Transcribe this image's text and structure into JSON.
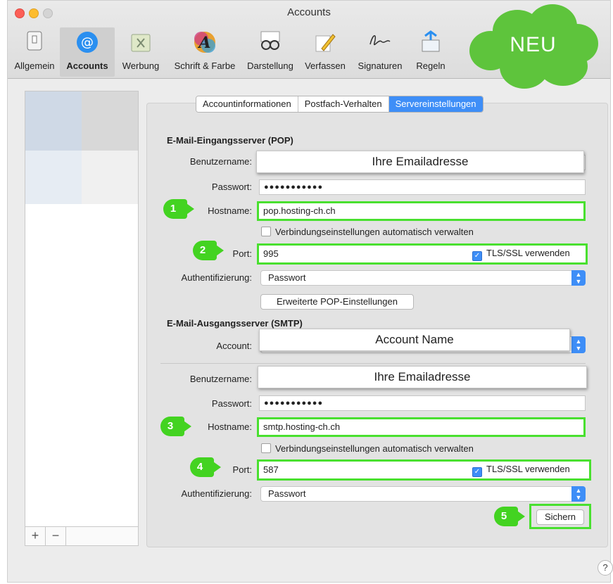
{
  "window": {
    "title": "Accounts"
  },
  "toolbar": {
    "items": [
      {
        "label": "Allgemein",
        "icon": "general-switch-icon"
      },
      {
        "label": "Accounts",
        "icon": "at-sign-icon"
      },
      {
        "label": "Werbung",
        "icon": "junk-bin-icon"
      },
      {
        "label": "Schrift & Farbe",
        "icon": "font-color-icon"
      },
      {
        "label": "Darstellung",
        "icon": "glasses-icon"
      },
      {
        "label": "Verfassen",
        "icon": "pencil-icon"
      },
      {
        "label": "Signaturen",
        "icon": "signature-icon"
      },
      {
        "label": "Regeln",
        "icon": "rules-envelope-icon"
      }
    ]
  },
  "badge": {
    "text": "NEU",
    "color": "#5ec43c"
  },
  "tabs": [
    {
      "label": "Accountinformationen"
    },
    {
      "label": "Postfach-Verhalten"
    },
    {
      "label": "Servereinstellungen"
    }
  ],
  "incoming": {
    "heading": "E-Mail-Eingangsserver (POP)",
    "username_label": "Benutzername:",
    "username_overlay": "Ihre Emailadresse",
    "password_label": "Passwort:",
    "password_value": "●●●●●●●●●●●",
    "hostname_label": "Hostname:",
    "hostname_value": "pop.hosting-ch.ch",
    "auto_label": "Verbindungseinstellungen automatisch verwalten",
    "port_label": "Port:",
    "port_value": "995",
    "tls_label": "TLS/SSL verwenden",
    "auth_label": "Authentifizierung:",
    "auth_value": "Passwort",
    "advanced_button": "Erweiterte POP-Einstellungen"
  },
  "outgoing": {
    "heading": "E-Mail-Ausgangsserver (SMTP)",
    "account_label": "Account:",
    "account_overlay": "Account Name",
    "username_label": "Benutzername:",
    "username_overlay": "Ihre Emailadresse",
    "password_label": "Passwort:",
    "password_value": "●●●●●●●●●●●",
    "hostname_label": "Hostname:",
    "hostname_value": "smtp.hosting-ch.ch",
    "auto_label": "Verbindungseinstellungen automatisch verwalten",
    "port_label": "Port:",
    "port_value": "587",
    "tls_label": "TLS/SSL verwenden",
    "auth_label": "Authentifizierung:",
    "auth_value": "Passwort",
    "save_button": "Sichern"
  },
  "markers": [
    "1",
    "2",
    "3",
    "4",
    "5"
  ],
  "sidebar": {
    "add": "+",
    "remove": "−"
  },
  "help": "?",
  "colors": {
    "highlight": "#49e02f",
    "marker": "#43d321",
    "accent": "#3e8ef7"
  }
}
